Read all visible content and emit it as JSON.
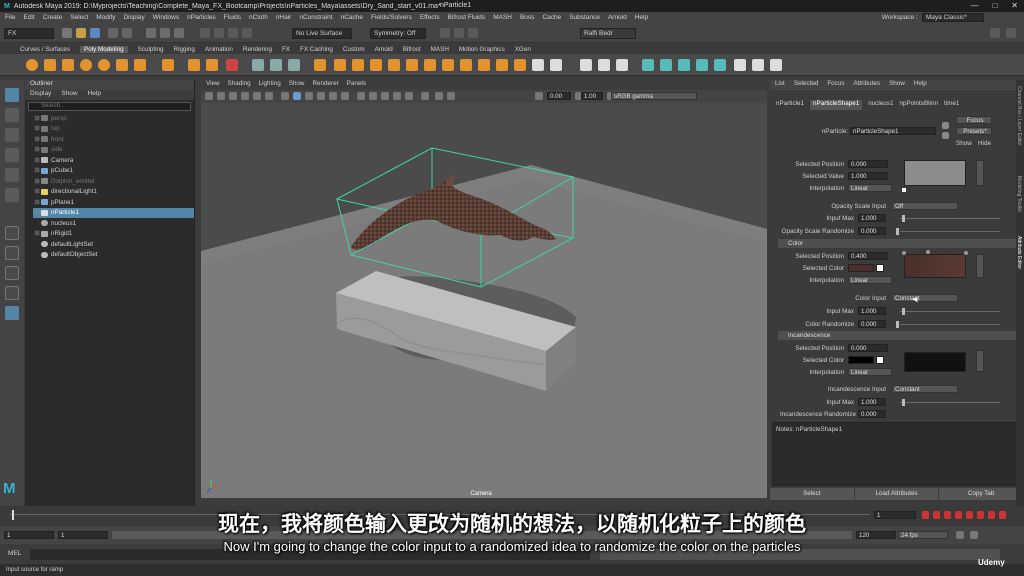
{
  "titlebar": {
    "title": "Autodesk Maya 2019: D:\\Myprojects\\Teaching\\Complete_Maya_FX_Bootcamp\\Projects\\nParticles_Maya\\assets\\Dry_Sand_start_v01.ma*",
    "center": "nParticle1",
    "min": "—",
    "max": "□",
    "close": "✕"
  },
  "menubar": {
    "items": [
      "File",
      "Edit",
      "Create",
      "Select",
      "Modify",
      "Display",
      "Windows",
      "nParticles",
      "Fluids",
      "nCloth",
      "nHair",
      "nConstraint",
      "nCache",
      "Fields/Solvers",
      "Effects",
      "Bifrost Fluids",
      "MASH",
      "Boss",
      "Cache",
      "Substance",
      "Arnold",
      "Help"
    ],
    "workspace_label": "Workspace :",
    "workspace_value": "Maya Classic*"
  },
  "statusline": {
    "mode": "FX",
    "live_surface": "No Live Surface",
    "symmetry": "Symmetry: Off",
    "user": "Raffi Bedr"
  },
  "shelf_tabs": [
    "Curves / Surfaces",
    "Poly Modeling",
    "Sculpting",
    "Rigging",
    "Animation",
    "Rendering",
    "FX",
    "FX Caching",
    "Custom",
    "Arnold",
    "Bifrost",
    "MASH",
    "Motion Graphics",
    "XGen"
  ],
  "shelf_active": "Poly Modeling",
  "outliner": {
    "title": "Outliner",
    "menu": [
      "Display",
      "Show",
      "Help"
    ],
    "search_placeholder": "Search...",
    "items": [
      {
        "label": "persp",
        "dim": true,
        "sel": false
      },
      {
        "label": "top",
        "dim": true,
        "sel": false
      },
      {
        "label": "front",
        "dim": true,
        "sel": false
      },
      {
        "label": "side",
        "dim": true,
        "sel": false
      },
      {
        "label": "Camera",
        "dim": false,
        "sel": false
      },
      {
        "label": "pCube1",
        "dim": false,
        "sel": false
      },
      {
        "label": "Dolphin_emitter",
        "dim": true,
        "sel": false
      },
      {
        "label": "directionalLight1",
        "dim": false,
        "sel": false
      },
      {
        "label": "pPlane1",
        "dim": false,
        "sel": false
      },
      {
        "label": "nParticle1",
        "dim": false,
        "sel": true
      },
      {
        "label": "nucleus1",
        "dim": false,
        "sel": false
      },
      {
        "label": "nRigid1",
        "dim": false,
        "sel": false
      },
      {
        "label": "defaultLightSet",
        "dim": false,
        "sel": false
      },
      {
        "label": "defaultObjectSet",
        "dim": false,
        "sel": false
      }
    ]
  },
  "viewport": {
    "menu": [
      "View",
      "Shading",
      "Lighting",
      "Show",
      "Renderer",
      "Panels"
    ],
    "val1": "0.00",
    "val2": "1.00",
    "colorspace": "sRGB gamma",
    "camera_label": "Camera"
  },
  "ae": {
    "menu": [
      "List",
      "Selected",
      "Focus",
      "Attributes",
      "Show",
      "Help"
    ],
    "tabs": [
      "nParticle1",
      "nParticleShape1",
      "nucleus1",
      "npPointsBlinn",
      "time1"
    ],
    "active_tab": "nParticleShape1",
    "node_label": "nParticle:",
    "node_value": "nParticleShape1",
    "focus": "Focus",
    "presets": "Presets*",
    "show": "Show",
    "hide": "Hide",
    "sel_pos_label": "Selected Position",
    "sel_pos_1": "0.000",
    "sel_val_label": "Selected Value",
    "sel_val_1": "1.000",
    "interp_label": "Interpolation",
    "interp_1": "Linear",
    "opacity_input_label": "Opacity Scale Input",
    "opacity_input": "Off",
    "input_max_label": "Input Max",
    "input_max_1": "1.000",
    "opacity_rand_label": "Opacity Scale Randomize",
    "opacity_rand": "0.000",
    "color_section": "Color",
    "sel_pos_2": "0.400",
    "sel_color_label": "Selected Color",
    "interp_2": "Linear",
    "color_input_label": "Color Input",
    "color_input": "Constant",
    "input_max_2": "1.000",
    "color_rand_label": "Color Randomize",
    "color_rand": "0.000",
    "incand_section": "Incandescence",
    "sel_pos_3": "0.000",
    "interp_3": "Linear",
    "incand_input_label": "Incandescence Input",
    "incand_input": "Constant",
    "input_max_3": "1.000",
    "incand_rand_label": "Incandescence Randomize",
    "incand_rand": "0.000",
    "notes": "Notes: nParticleShape1",
    "buttons": [
      "Select",
      "Load Attributes",
      "Copy Tab"
    ]
  },
  "side_tabs": [
    "Channel Box / Layer Editor",
    "Modeling Toolkit",
    "Attribute Editor"
  ],
  "timeline": {
    "start": "1",
    "start2": "1",
    "end": "120",
    "fps": "24 fps",
    "frame": "1"
  },
  "mel": {
    "label": "MEL",
    "help": "Input source for ramp"
  },
  "subtitles": {
    "cn": "现在，我将颜色输入更改为随机的想法，以随机化粒子上的颜色",
    "en": "Now I'm going to change the color input to a randomized idea to randomize the color on the particles"
  },
  "watermark": "Udemy",
  "logo": "M",
  "colors": {
    "accent": "#5285a6",
    "shelf_icon": "#e2932d",
    "particle": "#5a3e34",
    "bbox": "#3fd3a6",
    "sel_color": "#4a2f2a"
  }
}
